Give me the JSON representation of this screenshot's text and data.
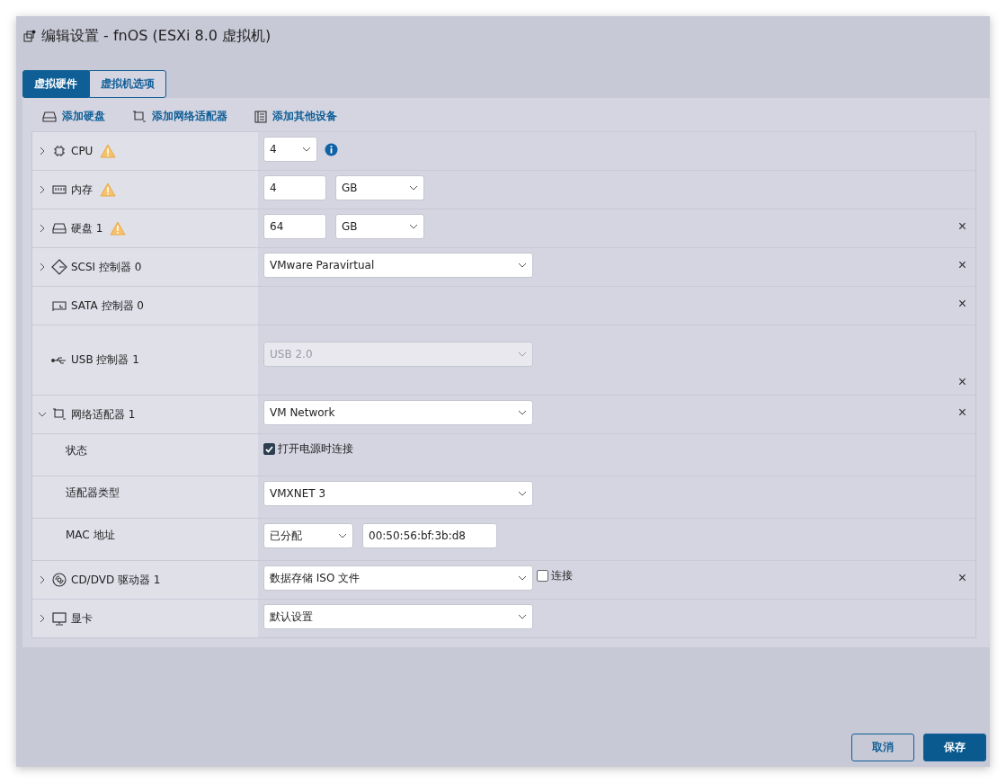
{
  "window": {
    "title": "编辑设置 - fnOS (ESXi 8.0 虚拟机)"
  },
  "tabs": [
    {
      "label": "虚拟硬件",
      "selected": true
    },
    {
      "label": "虚拟机选项",
      "selected": false
    }
  ],
  "toolbar": [
    {
      "kind": "disk",
      "label": "添加硬盘"
    },
    {
      "kind": "network",
      "label": "添加网络适配器"
    },
    {
      "kind": "device",
      "label": "添加其他设备"
    }
  ],
  "rows": [
    {
      "kind": "cpu",
      "label": "CPU",
      "expanded": false,
      "warning": true,
      "controls": [
        {
          "kind": "count-select",
          "value": "4",
          "disabled": false
        },
        {
          "kind": "info"
        }
      ]
    },
    {
      "kind": "memory",
      "label": "内存",
      "expanded": false,
      "warning": true,
      "controls": [
        {
          "kind": "number-input",
          "value": "4",
          "disabled": false
        },
        {
          "kind": "unit-select",
          "value": "GB",
          "disabled": false
        }
      ]
    },
    {
      "kind": "disk",
      "label": "硬盘 1",
      "expanded": false,
      "warning": true,
      "remove": "×",
      "controls": [
        {
          "kind": "number-input",
          "value": "64",
          "disabled": false
        },
        {
          "kind": "unit-select",
          "value": "GB",
          "disabled": false
        }
      ]
    },
    {
      "kind": "scsi",
      "label": "SCSI 控制器 0",
      "expanded": false,
      "warning": false,
      "remove": "×",
      "controls": [
        {
          "kind": "wide-select",
          "value": "VMware Paravirtual",
          "disabled": false
        }
      ]
    },
    {
      "kind": "sata",
      "label": "SATA 控制器 0",
      "warning": false,
      "remove": "×",
      "controls": []
    },
    {
      "kind": "usb",
      "label": "USB 控制器 1",
      "warning": false,
      "remove": "×",
      "controls": [
        {
          "kind": "wide-select",
          "value": "USB 2.0",
          "disabled": true
        }
      ]
    },
    {
      "kind": "network",
      "label": "网络适配器 1",
      "expanded": true,
      "warning": false,
      "remove": "×",
      "controls": [
        {
          "kind": "wide-select",
          "value": "VM Network",
          "disabled": false
        }
      ],
      "children": [
        {
          "label": "状态",
          "controls": [
            {
              "kind": "checkbox",
              "label": "打开电源时连接",
              "checked": true
            }
          ]
        },
        {
          "label": "适配器类型",
          "controls": [
            {
              "kind": "wide-select",
              "value": "VMXNET 3",
              "disabled": false
            }
          ]
        },
        {
          "label": "MAC 地址",
          "controls": [
            {
              "kind": "mode-select",
              "value": "已分配",
              "disabled": false
            },
            {
              "kind": "text-input",
              "value": "00:50:56:bf:3b:d8",
              "disabled": false
            }
          ]
        }
      ]
    },
    {
      "kind": "cdrom",
      "label": "CD/DVD 驱动器 1",
      "expanded": false,
      "warning": false,
      "remove": "×",
      "controls": [
        {
          "kind": "wide-select",
          "value": "数据存储 ISO 文件",
          "disabled": false
        },
        {
          "kind": "checkbox",
          "label": "连接",
          "checked": false
        }
      ]
    },
    {
      "kind": "display",
      "label": "显卡",
      "expanded": false,
      "warning": false,
      "controls": [
        {
          "kind": "wide-select",
          "value": "默认设置",
          "disabled": false
        }
      ]
    }
  ],
  "buttons": [
    {
      "kind": "secondary",
      "label": "取消"
    },
    {
      "kind": "primary",
      "label": "保存"
    }
  ]
}
